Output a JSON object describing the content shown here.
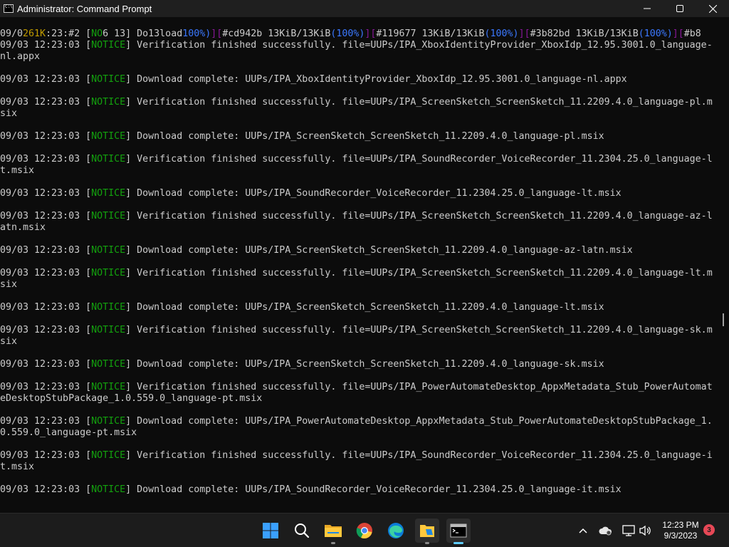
{
  "window": {
    "title": "Administrator: Command Prompt",
    "minimize": "minimize-icon",
    "maximize": "maximize-icon",
    "close": "close-icon"
  },
  "console": {
    "lines": [
      [
        [
          "09/0",
          ""
        ],
        [
          "261K",
          ""
        ],
        [
          ":23:#2 [",
          ""
        ],
        [
          "NO",
          ""
        ],
        [
          "6 13] Do13load",
          ""
        ],
        [
          "100%)",
          ""
        ],
        [
          "][",
          ""
        ],
        [
          "#cd942b 13KiB/13KiB",
          ""
        ],
        [
          "(100%)",
          ""
        ],
        [
          "][",
          ""
        ],
        [
          "#119677 13KiB/13KiB",
          ""
        ],
        [
          "(100%)",
          ""
        ],
        [
          "][",
          ""
        ],
        [
          "#3b82bd 13KiB/13KiB",
          ""
        ],
        [
          "(100%)",
          ""
        ],
        [
          "][",
          ""
        ],
        [
          "#b8",
          ""
        ]
      ],
      [
        [
          "09/03 12:23:03 [",
          ""
        ],
        [
          "NOTICE",
          ""
        ],
        [
          "] Verification finished successfully. file=UUPs/IPA_XboxIdentityProvider_XboxIdp_12.95.3001.0_language-",
          ""
        ]
      ],
      [
        [
          "nl.appx",
          ""
        ]
      ],
      [
        [
          "",
          ""
        ]
      ],
      [
        [
          "09/03 12:23:03 [",
          ""
        ],
        [
          "NOTICE",
          ""
        ],
        [
          "] Download complete: UUPs/IPA_XboxIdentityProvider_XboxIdp_12.95.3001.0_language-nl.appx",
          ""
        ]
      ],
      [
        [
          "",
          ""
        ]
      ],
      [
        [
          "09/03 12:23:03 [",
          ""
        ],
        [
          "NOTICE",
          ""
        ],
        [
          "] Verification finished successfully. file=UUPs/IPA_ScreenSketch_ScreenSketch_11.2209.4.0_language-pl.m",
          ""
        ]
      ],
      [
        [
          "six",
          ""
        ]
      ],
      [
        [
          "",
          ""
        ]
      ],
      [
        [
          "09/03 12:23:03 [",
          ""
        ],
        [
          "NOTICE",
          ""
        ],
        [
          "] Download complete: UUPs/IPA_ScreenSketch_ScreenSketch_11.2209.4.0_language-pl.msix",
          ""
        ]
      ],
      [
        [
          "",
          ""
        ]
      ],
      [
        [
          "09/03 12:23:03 [",
          ""
        ],
        [
          "NOTICE",
          ""
        ],
        [
          "] Verification finished successfully. file=UUPs/IPA_SoundRecorder_VoiceRecorder_11.2304.25.0_language-l",
          ""
        ]
      ],
      [
        [
          "t.msix",
          ""
        ]
      ],
      [
        [
          "",
          ""
        ]
      ],
      [
        [
          "09/03 12:23:03 [",
          ""
        ],
        [
          "NOTICE",
          ""
        ],
        [
          "] Download complete: UUPs/IPA_SoundRecorder_VoiceRecorder_11.2304.25.0_language-lt.msix",
          ""
        ]
      ],
      [
        [
          "",
          ""
        ]
      ],
      [
        [
          "09/03 12:23:03 [",
          ""
        ],
        [
          "NOTICE",
          ""
        ],
        [
          "] Verification finished successfully. file=UUPs/IPA_ScreenSketch_ScreenSketch_11.2209.4.0_language-az-l",
          ""
        ]
      ],
      [
        [
          "atn.msix",
          ""
        ]
      ],
      [
        [
          "",
          ""
        ]
      ],
      [
        [
          "09/03 12:23:03 [",
          ""
        ],
        [
          "NOTICE",
          ""
        ],
        [
          "] Download complete: UUPs/IPA_ScreenSketch_ScreenSketch_11.2209.4.0_language-az-latn.msix",
          ""
        ]
      ],
      [
        [
          "",
          ""
        ]
      ],
      [
        [
          "09/03 12:23:03 [",
          ""
        ],
        [
          "NOTICE",
          ""
        ],
        [
          "] Verification finished successfully. file=UUPs/IPA_ScreenSketch_ScreenSketch_11.2209.4.0_language-lt.m",
          ""
        ]
      ],
      [
        [
          "six",
          ""
        ]
      ],
      [
        [
          "",
          ""
        ]
      ],
      [
        [
          "09/03 12:23:03 [",
          ""
        ],
        [
          "NOTICE",
          ""
        ],
        [
          "] Download complete: UUPs/IPA_ScreenSketch_ScreenSketch_11.2209.4.0_language-lt.msix",
          ""
        ]
      ],
      [
        [
          "",
          ""
        ]
      ],
      [
        [
          "09/03 12:23:03 [",
          ""
        ],
        [
          "NOTICE",
          ""
        ],
        [
          "] Verification finished successfully. file=UUPs/IPA_ScreenSketch_ScreenSketch_11.2209.4.0_language-sk.m",
          ""
        ]
      ],
      [
        [
          "six",
          ""
        ]
      ],
      [
        [
          "",
          ""
        ]
      ],
      [
        [
          "09/03 12:23:03 [",
          ""
        ],
        [
          "NOTICE",
          ""
        ],
        [
          "] Download complete: UUPs/IPA_ScreenSketch_ScreenSketch_11.2209.4.0_language-sk.msix",
          ""
        ]
      ],
      [
        [
          "",
          ""
        ]
      ],
      [
        [
          "09/03 12:23:03 [",
          ""
        ],
        [
          "NOTICE",
          ""
        ],
        [
          "] Verification finished successfully. file=UUPs/IPA_PowerAutomateDesktop_AppxMetadata_Stub_PowerAutomat",
          ""
        ]
      ],
      [
        [
          "eDesktopStubPackage_1.0.559.0_language-pt.msix",
          ""
        ]
      ],
      [
        [
          "",
          ""
        ]
      ],
      [
        [
          "09/03 12:23:03 [",
          ""
        ],
        [
          "NOTICE",
          ""
        ],
        [
          "] Download complete: UUPs/IPA_PowerAutomateDesktop_AppxMetadata_Stub_PowerAutomateDesktopStubPackage_1.",
          ""
        ]
      ],
      [
        [
          "0.559.0_language-pt.msix",
          ""
        ]
      ],
      [
        [
          "",
          ""
        ]
      ],
      [
        [
          "09/03 12:23:03 [",
          ""
        ],
        [
          "NOTICE",
          ""
        ],
        [
          "] Verification finished successfully. file=UUPs/IPA_SoundRecorder_VoiceRecorder_11.2304.25.0_language-i",
          ""
        ]
      ],
      [
        [
          "t.msix",
          ""
        ]
      ],
      [
        [
          "",
          ""
        ]
      ],
      [
        [
          "09/03 12:23:03 [",
          ""
        ],
        [
          "NOTICE",
          ""
        ],
        [
          "] Download complete: UUPs/IPA_SoundRecorder_VoiceRecorder_11.2304.25.0_language-it.msix",
          ""
        ]
      ]
    ],
    "colors": {
      "text": "#cccccc",
      "notice": "#13a10e",
      "percent": "#3b78ff",
      "bracket": "#881798",
      "highlight": "#c19c00"
    }
  },
  "taskbar": {
    "apps": [
      {
        "name": "start-button",
        "icon": "windows-logo-icon"
      },
      {
        "name": "search-button",
        "icon": "search-icon"
      },
      {
        "name": "file-explorer-button",
        "icon": "folder-icon"
      },
      {
        "name": "chrome-button",
        "icon": "chrome-icon"
      },
      {
        "name": "edge-button",
        "icon": "edge-icon"
      },
      {
        "name": "folder-app-button",
        "icon": "folder-doc-icon"
      },
      {
        "name": "command-prompt-button",
        "icon": "terminal-icon"
      }
    ],
    "tray": {
      "chevron": "chevron-up-icon",
      "weather": "weather-icon",
      "network": "network-icon",
      "volume": "volume-icon"
    },
    "clock": {
      "time": "12:23 PM",
      "date": "9/3/2023"
    },
    "notifications": "3"
  }
}
